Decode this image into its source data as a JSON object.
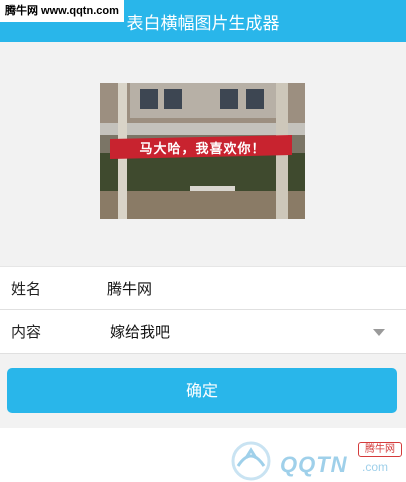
{
  "header": {
    "title": "表白横幅图片生成器"
  },
  "watermark_top": "腾牛网 www.qqtn.com",
  "preview": {
    "banner_text": "马大哈，我喜欢你！"
  },
  "form": {
    "name_label": "姓名",
    "name_value": "腾牛网",
    "content_label": "内容",
    "content_value": "嫁给我吧"
  },
  "confirm_label": "确定",
  "watermark_bottom": {
    "brand": "QQTN",
    "suffix": ".com",
    "badge": "腾牛网"
  },
  "colors": {
    "accent": "#29b6ea",
    "banner": "#c8232f"
  },
  "icons": [
    "dropdown-arrow-icon",
    "qqtn-logo-icon"
  ]
}
